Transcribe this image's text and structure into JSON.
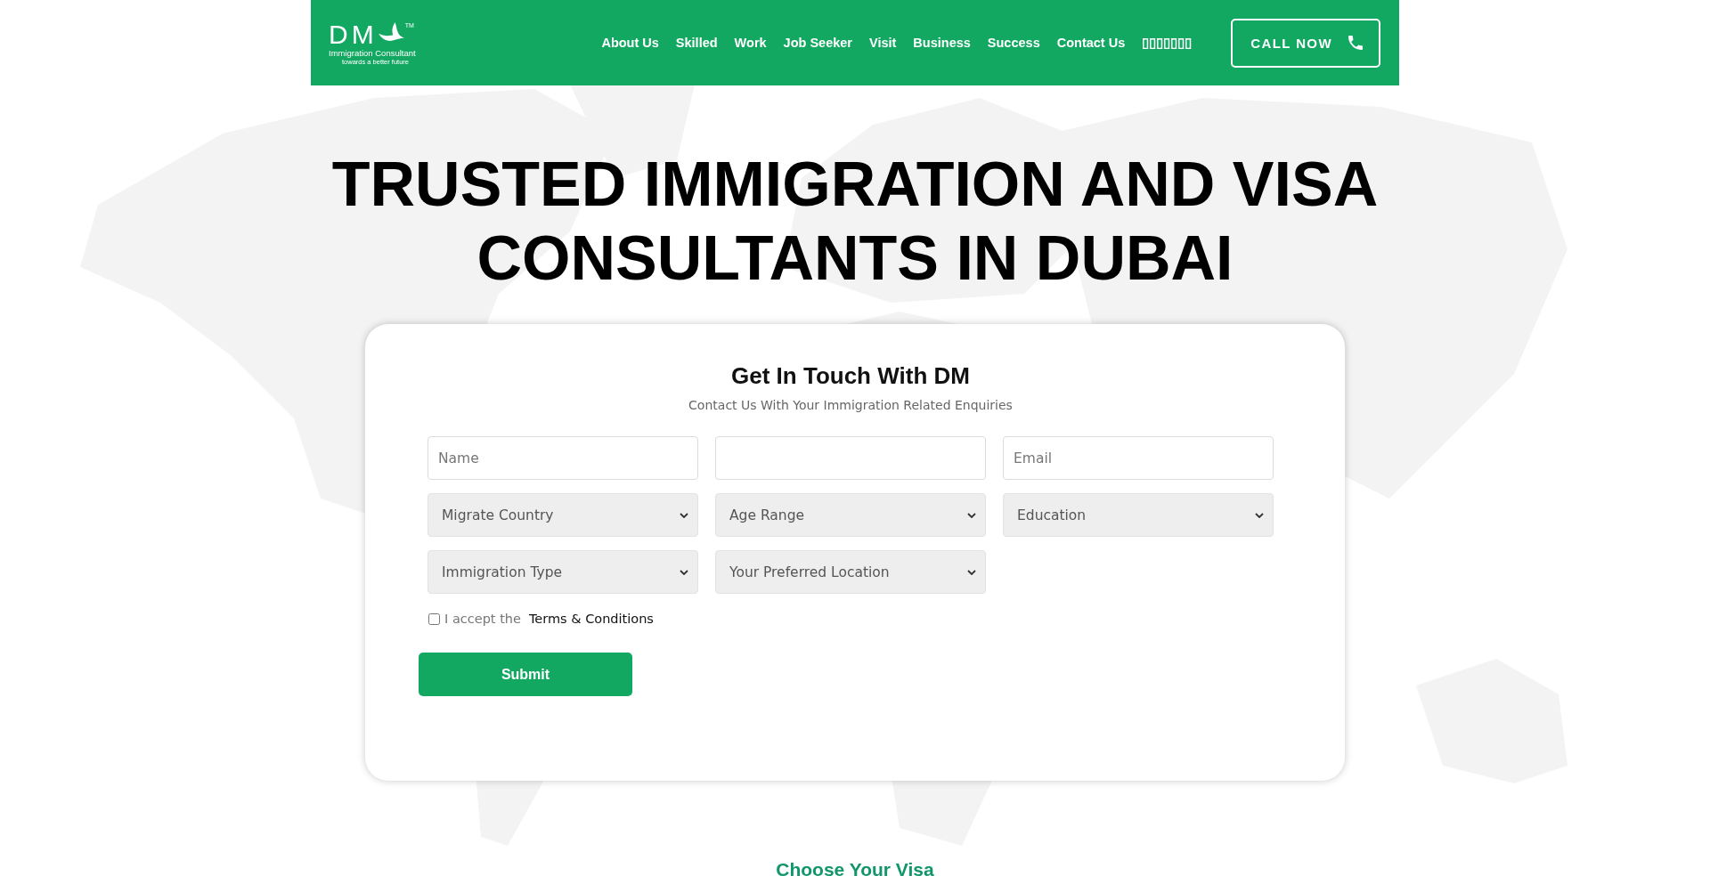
{
  "header": {
    "logo": {
      "wordmark": "DM",
      "trademark": "TM",
      "tagline": "Immigration Consultant",
      "slogan": "towards a better future"
    },
    "nav": [
      "About Us",
      "Skilled",
      "Work",
      "Job Seeker",
      "Visit",
      "Business",
      "Success",
      "Contact Us",
      "▯▯▯▯▯▯▯"
    ],
    "call_button": "CALL NOW"
  },
  "hero": {
    "title": "TRUSTED IMMIGRATION AND VISA CONSULTANTS IN DUBAI"
  },
  "form": {
    "title": "Get In Touch With DM",
    "subtitle": "Contact Us With Your Immigration Related Enquiries",
    "fields": [
      {
        "kind": "input",
        "placeholder": "Name"
      },
      {
        "kind": "input"
      },
      {
        "kind": "input",
        "placeholder": "Email"
      },
      {
        "kind": "select",
        "value": "Migrate Country"
      },
      {
        "kind": "select",
        "value": "Age Range"
      },
      {
        "kind": "select",
        "value": "Education"
      },
      {
        "kind": "select",
        "value": "Immigration Type"
      },
      {
        "kind": "select",
        "value": "Your Preferred Location"
      }
    ],
    "consent": {
      "checked": false,
      "label": "I accept the",
      "link": "Terms & Conditions"
    },
    "submit_button": "Submit"
  },
  "visa_section": {
    "heading": "Choose Your Visa"
  }
}
